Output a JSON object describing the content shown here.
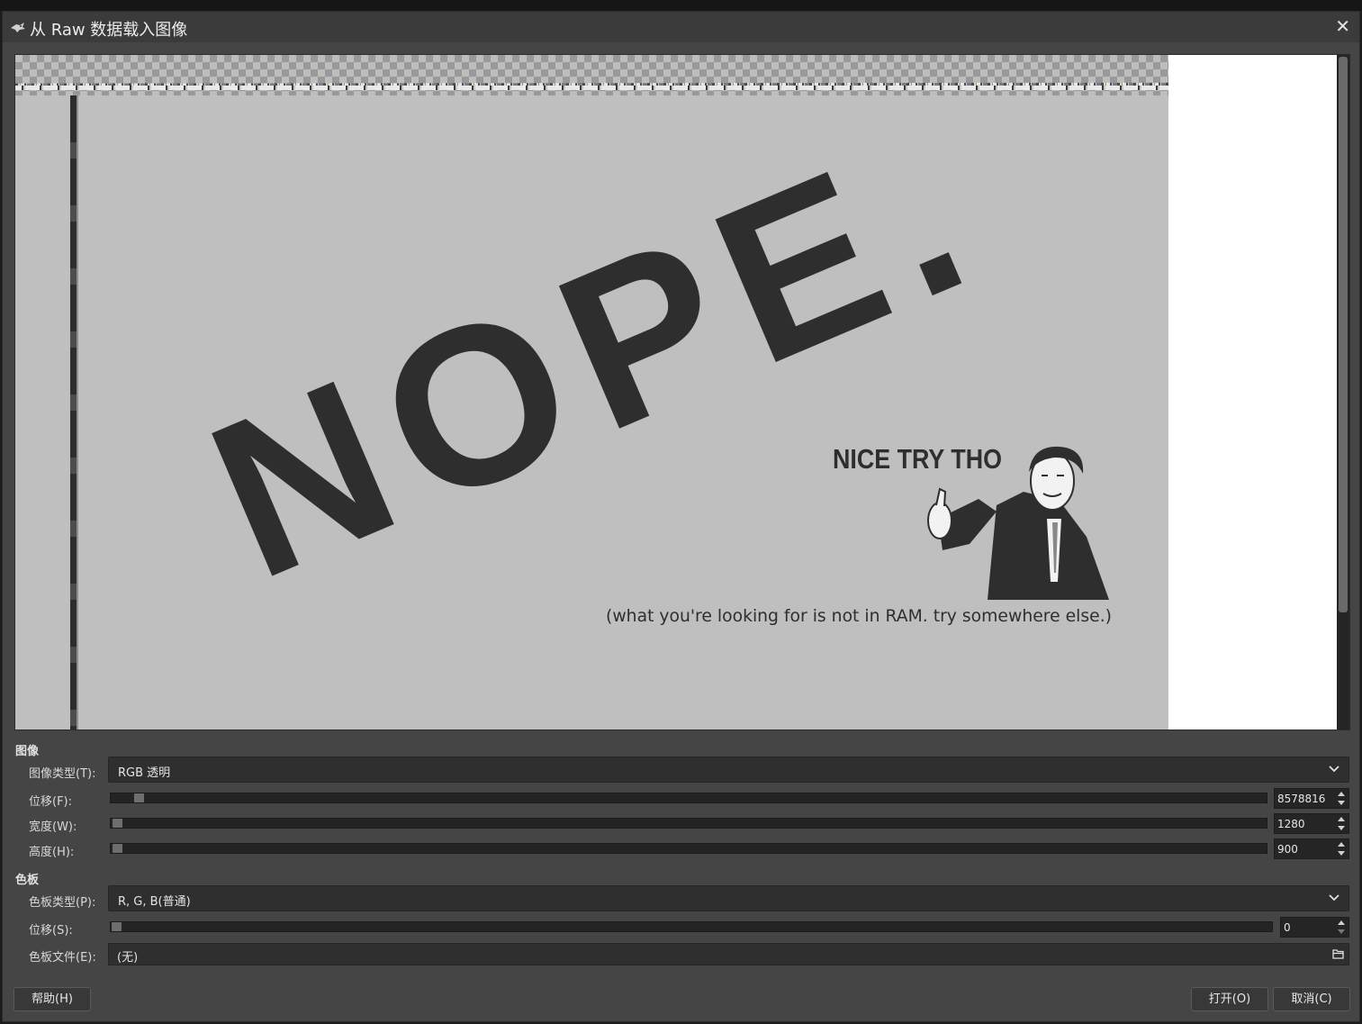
{
  "window": {
    "title": "从 Raw 数据载入图像",
    "close_glyph": "✕"
  },
  "preview": {
    "meme_big_text": "NOPE.",
    "meme_caption": "NICE TRY THO",
    "meme_subtext": "(what you're looking for is not in RAM. try somewhere else.)"
  },
  "image_section": {
    "heading": "图像",
    "type_label": "图像类型(T):",
    "type_value": "RGB 透明",
    "offset_label": "位移(F):",
    "offset_value": "8578816",
    "width_label": "宽度(W):",
    "width_value": "1280",
    "height_label": "高度(H):",
    "height_value": "900"
  },
  "palette_section": {
    "heading": "色板",
    "type_label": "色板类型(P):",
    "type_value": "R, G, B(普通)",
    "offset_label": "位移(S):",
    "offset_value": "0",
    "file_label": "色板文件(E):",
    "file_value": "(无)"
  },
  "buttons": {
    "help": "帮助(H)",
    "open": "打开(O)",
    "cancel": "取消(C)"
  },
  "icons": [
    "app-icon",
    "close-icon",
    "chevron-down-icon",
    "file-open-icon"
  ]
}
